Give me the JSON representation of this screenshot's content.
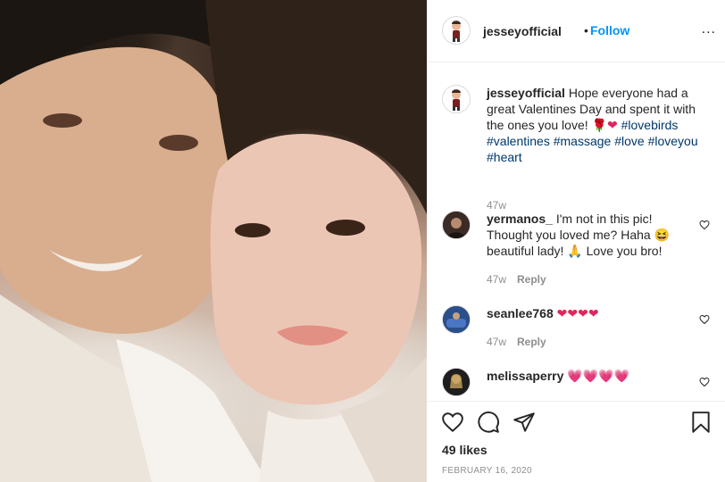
{
  "post": {
    "username": "jesseyofficial",
    "separator": "•",
    "follow_label": "Follow",
    "more_label": "..."
  },
  "caption": {
    "username": "jesseyofficial",
    "text": "Hope everyone had a great Valentines Day and spent it with the ones you love!",
    "hashtags": [
      "#lovebirds",
      "#valentines",
      "#massage",
      "#love",
      "#loveyou",
      "#heart"
    ],
    "time": "47w"
  },
  "comments": [
    {
      "username": "yermanos_",
      "text1": "I'm not in this pic! Thought you loved me? Haha",
      "text2": "beautiful lady!",
      "text3": "Love you bro!",
      "time": "47w",
      "reply_label": "Reply"
    },
    {
      "username": "seanlee768",
      "hearts": 4,
      "time": "47w",
      "reply_label": "Reply"
    },
    {
      "username": "melissaperry",
      "hearts": 4
    }
  ],
  "footer": {
    "likes": "49 likes",
    "date": "FEBRUARY 16, 2020"
  },
  "colors": {
    "link": "#0095f6",
    "hashtag": "#00376b",
    "heart": "#e0245e",
    "muted": "#8e8e8e"
  },
  "icons": [
    "like-icon",
    "comment-icon",
    "share-icon",
    "save-icon",
    "more-icon",
    "heart-outline-icon"
  ]
}
